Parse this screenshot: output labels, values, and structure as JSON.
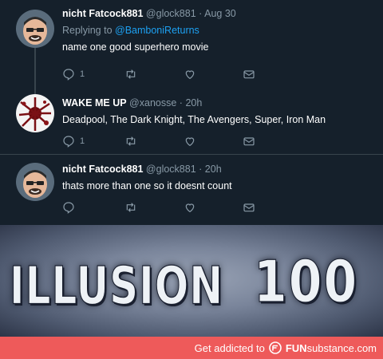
{
  "tweets": [
    {
      "name": "nicht Fatcock881",
      "handle": "@glock881",
      "sep": "·",
      "time": "Aug 30",
      "replying_prefix": "Replying to ",
      "replying_to": "@BamboniReturns",
      "text": "name one good superhero movie",
      "reply_count": "1",
      "retweet_count": "",
      "like_count": ""
    },
    {
      "name": "WAKE ME UP",
      "handle": "@xanosse",
      "sep": "·",
      "time": "20h",
      "text": "Deadpool, The Dark Knight, The Avengers, Super, Iron Man",
      "reply_count": "1",
      "retweet_count": "",
      "like_count": ""
    },
    {
      "name": "nicht Fatcock881",
      "handle": "@glock881",
      "sep": "·",
      "time": "20h",
      "text": "thats more than one so it doesnt count",
      "reply_count": "",
      "retweet_count": "",
      "like_count": ""
    }
  ],
  "meme": {
    "word1": "ILLUSION",
    "word2": "100"
  },
  "footer": {
    "prefix": "Get addicted to",
    "brand_fun": "FUN",
    "brand_rest": "substance",
    "suffix": ".com"
  },
  "colors": {
    "background": "#15202b",
    "accent": "#1da1f2",
    "muted": "#8899a6",
    "footer": "#ee5a5a"
  },
  "icons": [
    "reply-icon",
    "retweet-icon",
    "like-icon",
    "message-icon",
    "funsubstance-logo-icon"
  ]
}
